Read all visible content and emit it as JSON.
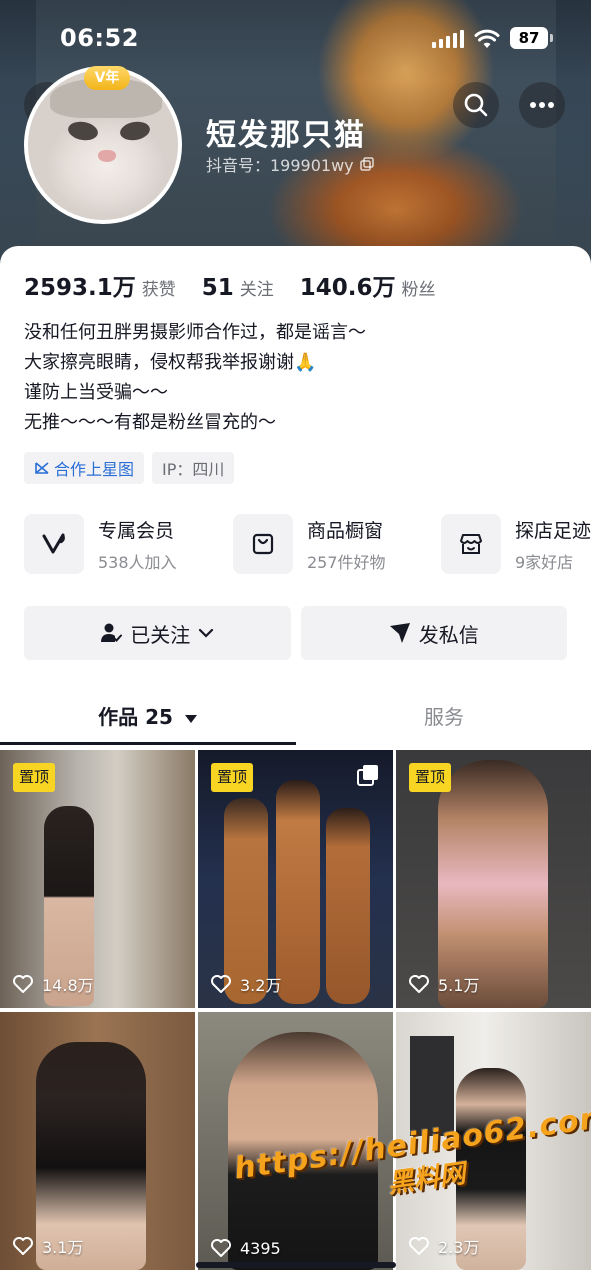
{
  "status_bar": {
    "time": "06:52",
    "battery": "87"
  },
  "profile": {
    "vip_badge": "V年",
    "name": "短发那只猫",
    "douyin_id": "抖音号：199901wy"
  },
  "stats": [
    {
      "value": "2593.1万",
      "label": "获赞"
    },
    {
      "value": "51",
      "label": "关注"
    },
    {
      "value": "140.6万",
      "label": "粉丝"
    }
  ],
  "bio": [
    "没和任何丑胖男摄影师合作过，都是谣言～",
    "大家擦亮眼睛，侵权帮我举报谢谢🙏",
    "谨防上当受骗～～",
    "无推～～～有都是粉丝冒充的～"
  ],
  "tags": {
    "star_map": "合作上星图",
    "ip": "IP：四川"
  },
  "services": [
    {
      "title": "专属会员",
      "sub": "538人加入",
      "icon": "v-logo-icon"
    },
    {
      "title": "商品橱窗",
      "sub": "257件好物",
      "icon": "shopping-bag-icon"
    },
    {
      "title": "探店足迹",
      "sub": "9家好店",
      "icon": "storefront-icon"
    }
  ],
  "actions": {
    "followed": "已关注",
    "message": "发私信"
  },
  "tabs": {
    "works": "作品 25",
    "service": "服务"
  },
  "posts": [
    {
      "pinned": "置顶",
      "likes": "14.8万",
      "multi": false
    },
    {
      "pinned": "置顶",
      "likes": "3.2万",
      "multi": true
    },
    {
      "pinned": "置顶",
      "likes": "5.1万",
      "multi": false
    },
    {
      "pinned": "",
      "likes": "3.1万",
      "multi": false
    },
    {
      "pinned": "",
      "likes": "4395",
      "multi": false
    },
    {
      "pinned": "",
      "likes": "2.3万",
      "multi": false
    }
  ],
  "watermark": {
    "url": "https://heiliao62.com",
    "name": "黑料网"
  },
  "colors": {
    "accent_blue": "#2b6fd6",
    "pin_yellow": "#f9d523",
    "text_primary": "#161823",
    "text_secondary": "#6b6e75"
  }
}
